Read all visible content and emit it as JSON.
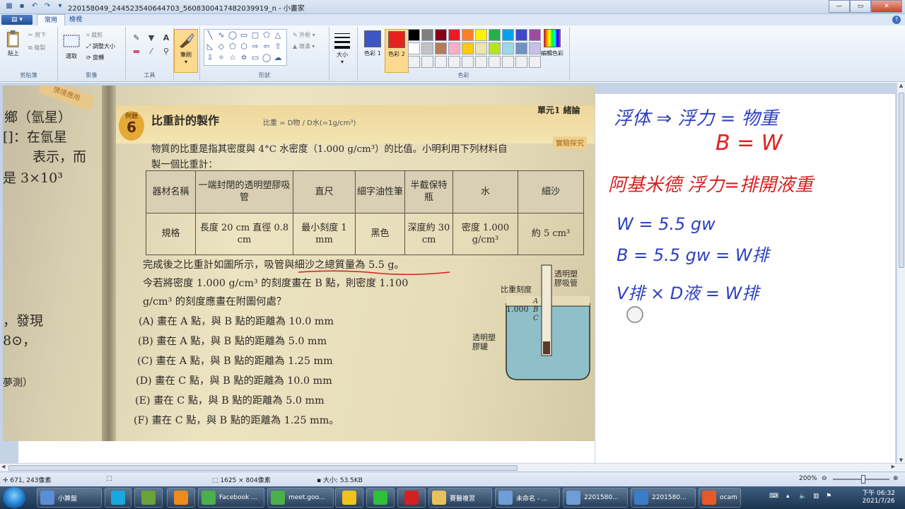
{
  "window": {
    "title": "220158049_244523540644703_5608300417482039919_n - 小畫家"
  },
  "tabs": [
    {
      "label": "常用",
      "active": true
    },
    {
      "label": "檢視",
      "active": false
    }
  ],
  "ribbon": {
    "clipboard": {
      "paste": "貼上",
      "cut": "剪下",
      "copy": "複製",
      "group": "剪貼簿"
    },
    "image": {
      "select": "選取",
      "crop": "裁剪",
      "resize": "調整大小",
      "rotate": "旋轉",
      "group": "影像"
    },
    "tools": {
      "group": "工具"
    },
    "brush": {
      "label": "筆刷"
    },
    "shapes": {
      "outline": "外框",
      "fill": "填滿",
      "group": "形狀"
    },
    "size": {
      "label": "大小"
    },
    "colors": {
      "color1_label": "色彩 1",
      "color2_label": "色彩 2",
      "edit_label": "編輯色彩",
      "group": "色彩",
      "color1": "#3d56c6",
      "color2": "#e5231c",
      "palette": [
        "#000000",
        "#7f7f7f",
        "#880015",
        "#ed1c24",
        "#ff7f27",
        "#fff200",
        "#22b14c",
        "#00a2e8",
        "#3f48cc",
        "#a349a4",
        "#ffffff",
        "#c3c3c3",
        "#b97a57",
        "#ffaec9",
        "#ffc90e",
        "#efe4b0",
        "#b5e61d",
        "#99d9ea",
        "#7092be",
        "#c8bfe7",
        "#f0f0f0",
        "#f0f0f0",
        "#f0f0f0",
        "#f0f0f0",
        "#f0f0f0",
        "#f0f0f0",
        "#f0f0f0",
        "#f0f0f0",
        "#f0f0f0",
        "#f0f0f0"
      ]
    }
  },
  "textbook": {
    "left_lines": [
      "鄉（氫星）",
      "[]：在氫星",
      "表示，而",
      "是 3×10³",
      "，發現",
      "8⊙，",
      "夢測）"
    ],
    "corner_tag": "情境應用",
    "example_label": "例題",
    "example_num": "6",
    "heading": "比重計的製作",
    "unit_label": "單元1  緒論",
    "inquiry_tag": "實驗探究",
    "intro_line1": "物質的比重是指其密度與 4°C 水密度（1.000 g/cm³）的比值。小明利用下列材料自",
    "intro_line2": "製一個比重計：",
    "table": {
      "row1": [
        "器材名稱",
        "一端封閉的透明塑膠吸管",
        "直尺",
        "細字油性筆",
        "半截保特瓶",
        "水",
        "細沙"
      ],
      "row2": [
        "規格",
        "長度 20 cm 直徑 0.8 cm",
        "最小刻度 1 mm",
        "黑色",
        "深度約 30 cm",
        "密度 1.000 g/cm³",
        "約 5 cm³"
      ]
    },
    "q_line1": "完成後之比重計如圖所示，吸管與細沙之總質量為 5.5 g。",
    "q_line2": "今若將密度 1.000 g/cm³ 的刻度畫在 B 點，則密度 1.100",
    "q_line3": "g/cm³ 的刻度應畫在附圖何處？",
    "options": [
      "(A) 畫在 A 點，與 B 點的距離為 10.0 mm",
      "(B) 畫在 A 點，與 B 點的距離為 5.0 mm",
      "(C) 畫在 A 點，與 B 點的距離為 1.25 mm",
      "(D) 畫在 C 點，與 B 點的距離為 10.0 mm",
      "(E) 畫在 C 點，與 B 點的距離為 5.0 mm",
      "(F) 畫在 C 點，與 B 點的距離為 1.25 mm。"
    ],
    "figure": {
      "scale_label": "比重刻度",
      "scale_value": "1.000",
      "points": [
        "A",
        "B",
        "C"
      ],
      "tube_label": "透明塑膠吸管",
      "bottle_label": "透明塑膠罐"
    },
    "pencil_note": "比重 = D物 / D水(=1g/cm³)"
  },
  "notes": {
    "line1": "浮体 ⇒ 浮力 = 物重",
    "line2": "B = W",
    "line3": "阿基米德 浮力=排開液重",
    "line4": "W = 5.5 gw",
    "line5": "B = 5.5 gw = W排",
    "line6": "V排 × D液 = W排"
  },
  "statusbar": {
    "cursor_pos": "671, 243像素",
    "image_size": "1625 × 804像素",
    "file_size": "大小: 53.5KB",
    "zoom": "200%"
  },
  "taskbar": {
    "items": [
      {
        "label": "小算盤",
        "color": "#5a8ed6"
      },
      {
        "label": "",
        "color": "#18a8e0"
      },
      {
        "label": "",
        "color": "#6aa23a"
      },
      {
        "label": "",
        "color": "#f08a1c"
      },
      {
        "label": "Facebook ...",
        "color": "#4ab04a"
      },
      {
        "label": "meet.goo...",
        "color": "#4ab04a"
      },
      {
        "label": "",
        "color": "#f2c21c"
      },
      {
        "label": "",
        "color": "#2fbf3a"
      },
      {
        "label": "",
        "color": "#d42020"
      },
      {
        "label": "賽醫複習",
        "color": "#e9c15a"
      },
      {
        "label": "未命名 - ...",
        "color": "#6f9ed6"
      },
      {
        "label": "2201580...",
        "color": "#6f9ed6"
      },
      {
        "label": "2201580...",
        "color": "#3a7cc7"
      },
      {
        "label": "ocam",
        "color": "#e65a2a"
      }
    ],
    "time": "下午 06:32",
    "date": "2021/7/26"
  }
}
